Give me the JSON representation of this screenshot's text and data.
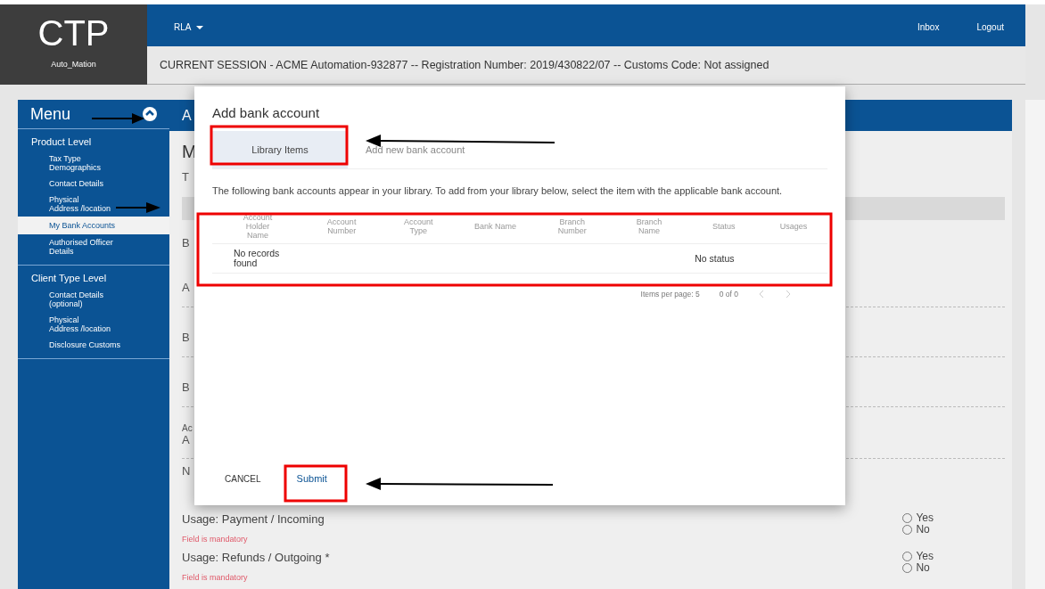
{
  "header": {
    "logo": "CTP",
    "user": "Auto_Mation",
    "menu": "RLA",
    "links": [
      "Inbox",
      "Logout"
    ],
    "session": "CURRENT SESSION - ACME Automation-932877 -- Registration Number: 2019/430822/07 -- Customs Code: Not assigned"
  },
  "sidebar": {
    "title": "Menu",
    "groups": [
      {
        "label": "Product Level",
        "items": [
          {
            "label": "Tax Type\nDemographics",
            "selected": false
          },
          {
            "label": "Contact Details",
            "selected": false
          },
          {
            "label": "Physical\nAddress /location",
            "selected": false
          },
          {
            "label": "My Bank Accounts",
            "selected": true
          },
          {
            "label": "Authorised Officer\nDetails",
            "selected": false
          }
        ]
      },
      {
        "label": "Client Type Level",
        "items": [
          {
            "label": "Contact Details\n(optional)",
            "selected": false
          },
          {
            "label": "Physical\nAddress /location",
            "selected": false
          },
          {
            "label": "Disclosure Customs",
            "selected": false
          }
        ]
      }
    ]
  },
  "page": {
    "header": "A",
    "fragments": [
      {
        "kind": "heading",
        "text": "M"
      },
      {
        "kind": "label",
        "text": "T"
      },
      {
        "kind": "field"
      },
      {
        "kind": "label",
        "text": "B"
      },
      {
        "kind": "line",
        "text": "A"
      },
      {
        "kind": "line",
        "text": "B"
      },
      {
        "kind": "line",
        "text": "B"
      },
      {
        "kind": "double",
        "text": "Ac",
        "value": "A"
      },
      {
        "kind": "label",
        "text": "N"
      }
    ]
  },
  "questions": [
    {
      "label": "Usage: Payment / Incoming",
      "error": "Field is mandatory",
      "options": [
        {
          "label": "Yes",
          "selected": false
        },
        {
          "label": "No",
          "selected": false
        }
      ]
    },
    {
      "label": "Usage: Refunds / Outgoing *",
      "error": "Field is mandatory",
      "options": [
        {
          "label": "Yes",
          "selected": false
        },
        {
          "label": "No",
          "selected": false
        }
      ]
    }
  ],
  "modal": {
    "title": "Add bank account",
    "tabs": [
      {
        "label": "Library Items",
        "selected": true
      },
      {
        "label": "Add new bank account",
        "selected": false
      }
    ],
    "intro": "The following bank accounts appear in your library. To add from your library below, select the item with the applicable bank account.",
    "table": {
      "columns": [
        "Account\nHolder\nName",
        "Account\nNumber",
        "Account\nType",
        "Bank Name",
        "Branch\nNumber",
        "Branch\nName",
        "Status",
        "Usages"
      ],
      "rows": [
        [
          "No records\nfound",
          "",
          "",
          "",
          "",
          "",
          "No status",
          ""
        ]
      ]
    },
    "pagination": {
      "label": "Items per page: 5",
      "range": "0 of 0"
    },
    "buttons": [
      {
        "label": "CANCEL",
        "kind": "plain"
      },
      {
        "label": "Submit",
        "kind": "primary"
      }
    ]
  }
}
